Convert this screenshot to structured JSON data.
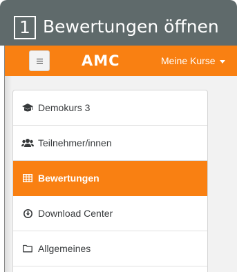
{
  "banner": {
    "step_number": "1",
    "title": "Bewertungen öffnen"
  },
  "navbar": {
    "brand": "AMC",
    "courses_menu": "Meine Kurse",
    "accent_color": "#f98012"
  },
  "navigation": {
    "items": [
      {
        "label": "Demokurs 3",
        "icon": "graduation-cap-icon",
        "active": false
      },
      {
        "label": "Teilnehmer/innen",
        "icon": "users-icon",
        "active": false
      },
      {
        "label": "Bewertungen",
        "icon": "table-icon",
        "active": true
      },
      {
        "label": "Download Center",
        "icon": "download-circle-icon",
        "active": false
      },
      {
        "label": "Allgemeines",
        "icon": "folder-icon",
        "active": false
      }
    ]
  }
}
